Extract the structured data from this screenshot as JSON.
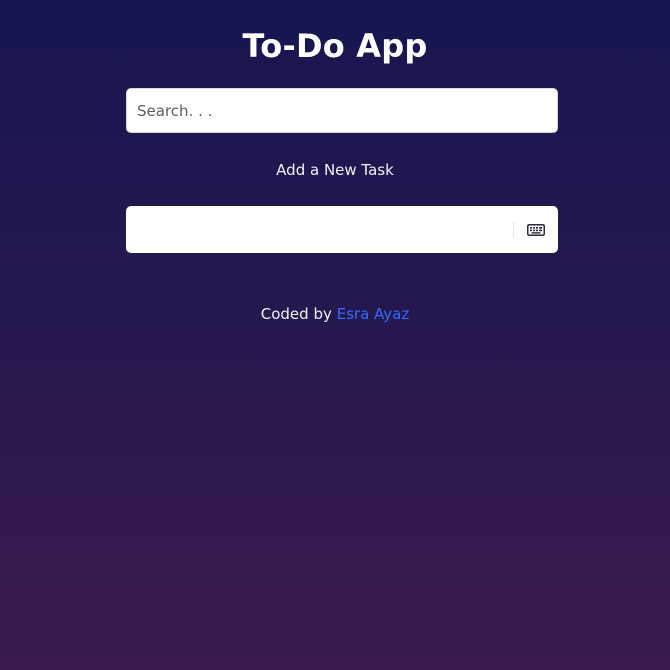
{
  "app": {
    "title": "To-Do App"
  },
  "search": {
    "placeholder": "Search. . .",
    "value": ""
  },
  "add_task": {
    "label": "Add a New Task",
    "value": "",
    "icon": "keyboard-icon"
  },
  "footer": {
    "prefix": "Coded by",
    "author_name": "Esra Ayaz"
  },
  "colors": {
    "background_top": "#161650",
    "background_bottom": "#3a1a4f",
    "link": "#2f6bff",
    "input_bg": "#ffffff"
  }
}
